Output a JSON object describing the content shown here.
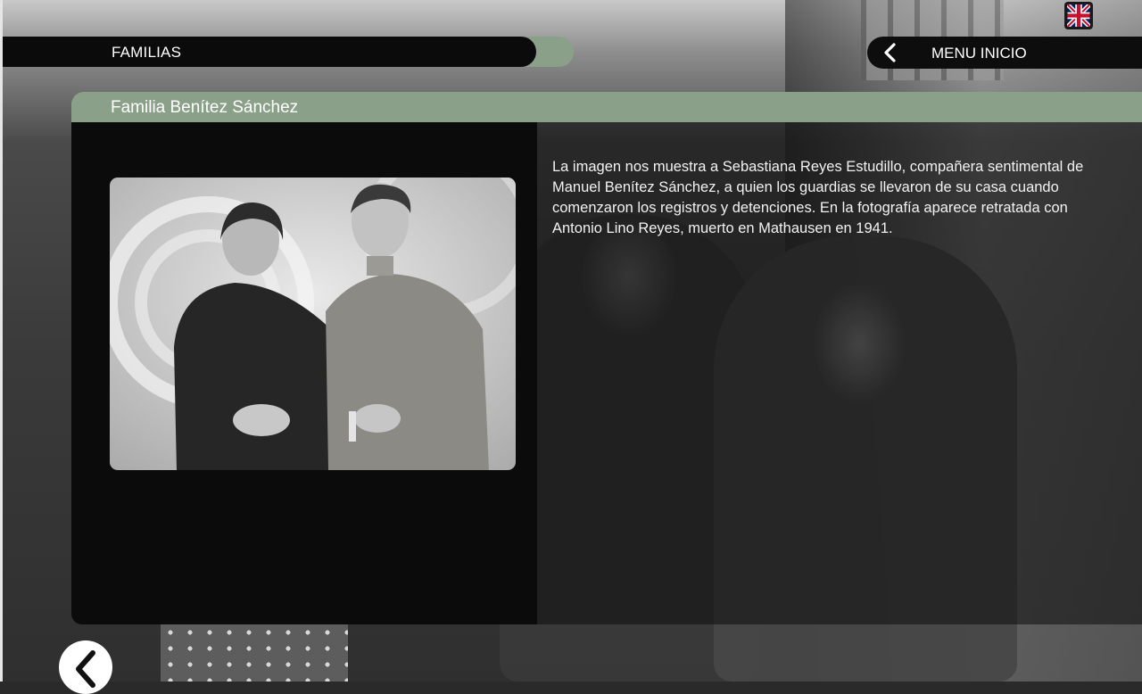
{
  "header": {
    "section_title": "FAMILIAS",
    "menu_label": "MENU INICIO",
    "language_flag": "uk-flag-icon"
  },
  "panel": {
    "title": "Familia Benítez Sánchez",
    "description": "La imagen nos muestra a Sebastiana Reyes Estudillo, compañera sentimental de Manuel Benítez Sánchez, a quien los guardias se llevaron de su casa cuando comenzaron los registros y detenciones. En la fotografía aparece retratada con Antonio Lino Reyes, muerto en Mathausen en 1941."
  },
  "navigation": {
    "back_icon": "chevron-left-icon",
    "menu_icon": "chevron-left-icon"
  },
  "colors": {
    "accent_green": "#8ba088",
    "bar_black": "#0b0b0b",
    "text": "#ffffff"
  }
}
